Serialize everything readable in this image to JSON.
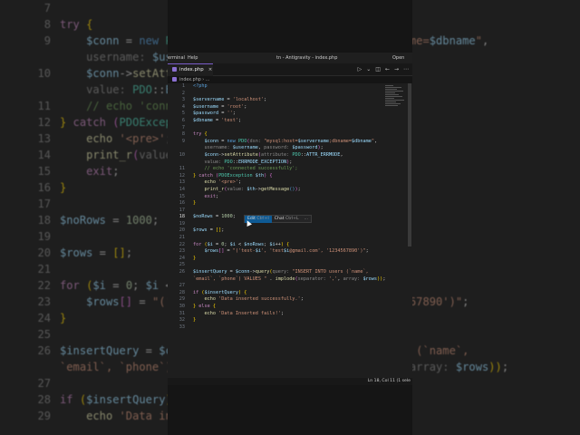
{
  "menubar": {
    "items": [
      "erminal",
      "Help"
    ],
    "title": "tn - Antigravity - index.php",
    "right": "Open Age"
  },
  "tab": {
    "label": "index.php",
    "close": "×",
    "icon": "php-file-icon"
  },
  "tab_actions": [
    "▷",
    "⌄",
    "◫",
    "←",
    "→",
    "⋯"
  ],
  "breadcrumb": "index.php › ...",
  "inline_popup": {
    "edit": "Edit",
    "edit_kbd": "Ctrl+I",
    "chat": "Chat",
    "chat_kbd": "Ctrl+L",
    "more": "..."
  },
  "status": {
    "position": "Ln 18, Col 11 (1 sele"
  },
  "colors": {
    "accent": "#7a5cc9",
    "editor_bg": "#1e1e1e",
    "popup_edit": "#0e5a94"
  },
  "code": [
    {
      "n": "1",
      "t": [
        [
          "<?php",
          "t"
        ]
      ]
    },
    {
      "n": "2",
      "t": []
    },
    {
      "n": "3",
      "t": [
        [
          "$servername",
          "v"
        ],
        [
          " = ",
          "p"
        ],
        [
          "'localhost'",
          "s"
        ],
        [
          ";",
          "p"
        ]
      ]
    },
    {
      "n": "4",
      "t": [
        [
          "$username",
          "v"
        ],
        [
          " = ",
          "p"
        ],
        [
          "'root'",
          "s"
        ],
        [
          ";",
          "p"
        ]
      ]
    },
    {
      "n": "5",
      "t": [
        [
          "$password",
          "v"
        ],
        [
          " = ",
          "p"
        ],
        [
          "''",
          "s"
        ],
        [
          ";",
          "p"
        ]
      ]
    },
    {
      "n": "6",
      "t": [
        [
          "$dbname",
          "v"
        ],
        [
          " = ",
          "p"
        ],
        [
          "'test'",
          "s"
        ],
        [
          ";",
          "p"
        ]
      ]
    },
    {
      "n": "7",
      "t": []
    },
    {
      "n": "8",
      "t": [
        [
          "try",
          "k"
        ],
        [
          " {",
          "b"
        ]
      ]
    },
    {
      "n": "9",
      "t": [
        [
          "    $conn",
          "v"
        ],
        [
          " = ",
          "p"
        ],
        [
          "new ",
          "t"
        ],
        [
          "PDO",
          "c"
        ],
        [
          "(",
          "b2"
        ],
        [
          "dsn: ",
          "h"
        ],
        [
          "\"mysql:host=",
          "s"
        ],
        [
          "$servername",
          "v"
        ],
        [
          ";dbname=",
          "s"
        ],
        [
          "$dbname",
          "v"
        ],
        [
          "\"",
          "s"
        ],
        [
          ",",
          "p"
        ]
      ]
    },
    {
      "n": "",
      "t": [
        [
          "    username: ",
          "h"
        ],
        [
          "$username",
          "v"
        ],
        [
          ", ",
          "p"
        ],
        [
          "password: ",
          "h"
        ],
        [
          "$password",
          "v"
        ],
        [
          ")",
          "b2"
        ],
        [
          ";",
          "p"
        ]
      ]
    },
    {
      "n": "10",
      "t": [
        [
          "    $conn",
          "v"
        ],
        [
          "->",
          "p"
        ],
        [
          "setAttribute",
          "f"
        ],
        [
          "(",
          "b2"
        ],
        [
          "attribute: ",
          "h"
        ],
        [
          "PDO",
          "c"
        ],
        [
          "::",
          "p"
        ],
        [
          "ATTR_ERRMODE",
          "v"
        ],
        [
          ",",
          "p"
        ]
      ]
    },
    {
      "n": "",
      "t": [
        [
          "    value: ",
          "h"
        ],
        [
          "PDO",
          "c"
        ],
        [
          "::",
          "p"
        ],
        [
          "ERRMODE_EXCEPTION",
          "v"
        ],
        [
          ")",
          "b2"
        ],
        [
          ";",
          "p"
        ]
      ]
    },
    {
      "n": "11",
      "t": [
        [
          "    // echo 'connected successfully';",
          "m"
        ]
      ]
    },
    {
      "n": "12",
      "t": [
        [
          "}",
          "b"
        ],
        [
          " catch ",
          "k"
        ],
        [
          "(",
          "b2"
        ],
        [
          "PDOException",
          "c"
        ],
        [
          " $th",
          "v"
        ],
        [
          ")",
          "b2"
        ],
        [
          " {",
          "b2"
        ]
      ]
    },
    {
      "n": "13",
      "t": [
        [
          "    echo ",
          "f"
        ],
        [
          "'<pre>'",
          "s"
        ],
        [
          ";",
          "p"
        ]
      ]
    },
    {
      "n": "14",
      "t": [
        [
          "    print_r",
          "f"
        ],
        [
          "(",
          "b2"
        ],
        [
          "value: ",
          "h"
        ],
        [
          "$th",
          "v"
        ],
        [
          "->",
          "p"
        ],
        [
          "getMessage",
          "f"
        ],
        [
          "()",
          "t"
        ],
        [
          ")",
          "b2"
        ],
        [
          ";",
          "p"
        ]
      ]
    },
    {
      "n": "15",
      "t": [
        [
          "    exit",
          "k"
        ],
        [
          ";",
          "p"
        ]
      ]
    },
    {
      "n": "16",
      "t": [
        [
          "}",
          "b"
        ]
      ]
    },
    {
      "n": "17",
      "t": []
    },
    {
      "n": "18",
      "t": [
        [
          "$noRows",
          "v"
        ],
        [
          " = ",
          "p"
        ],
        [
          "1000",
          "n"
        ],
        [
          ";",
          "p"
        ]
      ],
      "cur": true
    },
    {
      "n": "19",
      "t": []
    },
    {
      "n": "20",
      "t": [
        [
          "$rows",
          "v"
        ],
        [
          " = ",
          "p"
        ],
        [
          "[]",
          "b"
        ],
        [
          ";",
          "p"
        ]
      ]
    },
    {
      "n": "21",
      "t": []
    },
    {
      "n": "22",
      "t": [
        [
          "for ",
          "k"
        ],
        [
          "(",
          "b"
        ],
        [
          "$i",
          "v"
        ],
        [
          " = ",
          "p"
        ],
        [
          "0",
          "n"
        ],
        [
          "; ",
          "p"
        ],
        [
          "$i",
          "v"
        ],
        [
          " < ",
          "p"
        ],
        [
          "$noRows",
          "v"
        ],
        [
          "; ",
          "p"
        ],
        [
          "$i",
          "v"
        ],
        [
          "++",
          "p"
        ],
        [
          ")",
          "b"
        ],
        [
          " {",
          "b"
        ]
      ]
    },
    {
      "n": "23",
      "t": [
        [
          "    $rows",
          "v"
        ],
        [
          "[]",
          "b2"
        ],
        [
          " = ",
          "p"
        ],
        [
          "\"('test-",
          "s"
        ],
        [
          "$i",
          "v"
        ],
        [
          "', 'test",
          "s"
        ],
        [
          "$i",
          "v"
        ],
        [
          "@gmail.com', '1234567890')\"",
          "s"
        ],
        [
          ";",
          "p"
        ]
      ]
    },
    {
      "n": "24",
      "t": [
        [
          "}",
          "b"
        ]
      ]
    },
    {
      "n": "25",
      "t": []
    },
    {
      "n": "26",
      "t": [
        [
          "$insertQuery",
          "v"
        ],
        [
          " = ",
          "p"
        ],
        [
          "$conn",
          "v"
        ],
        [
          "->",
          "p"
        ],
        [
          "query",
          "f"
        ],
        [
          "(",
          "b"
        ],
        [
          "query: ",
          "h"
        ],
        [
          "\"INSERT INTO users (`name`,",
          "s"
        ]
      ]
    },
    {
      "n": "",
      "t": [
        [
          "`email`, `phone`) VALUES \"",
          "s"
        ],
        [
          " . ",
          "p"
        ],
        [
          "implode",
          "f"
        ],
        [
          "(",
          "b2"
        ],
        [
          "separator: ",
          "h"
        ],
        [
          "','",
          "s"
        ],
        [
          ", ",
          "p"
        ],
        [
          "array: ",
          "h"
        ],
        [
          "$rows",
          "v"
        ],
        [
          "))",
          "b"
        ],
        [
          ";",
          "p"
        ]
      ]
    },
    {
      "n": "27",
      "t": []
    },
    {
      "n": "28",
      "t": [
        [
          "if ",
          "k"
        ],
        [
          "(",
          "b"
        ],
        [
          "$insertQuery",
          "v"
        ],
        [
          ")",
          "b"
        ],
        [
          " {",
          "b"
        ]
      ]
    },
    {
      "n": "29",
      "t": [
        [
          "    echo ",
          "f"
        ],
        [
          "'Data inserted successfully.'",
          "s"
        ],
        [
          ";",
          "p"
        ]
      ]
    },
    {
      "n": "30",
      "t": [
        [
          "}",
          "b"
        ],
        [
          " else ",
          "k"
        ],
        [
          "{",
          "b"
        ]
      ]
    },
    {
      "n": "31",
      "t": [
        [
          "    echo ",
          "f"
        ],
        [
          "'Data Inserted fails!'",
          "s"
        ],
        [
          ";",
          "p"
        ]
      ]
    },
    {
      "n": "32",
      "t": [
        [
          "}",
          "b"
        ]
      ]
    },
    {
      "n": "33",
      "t": []
    }
  ]
}
